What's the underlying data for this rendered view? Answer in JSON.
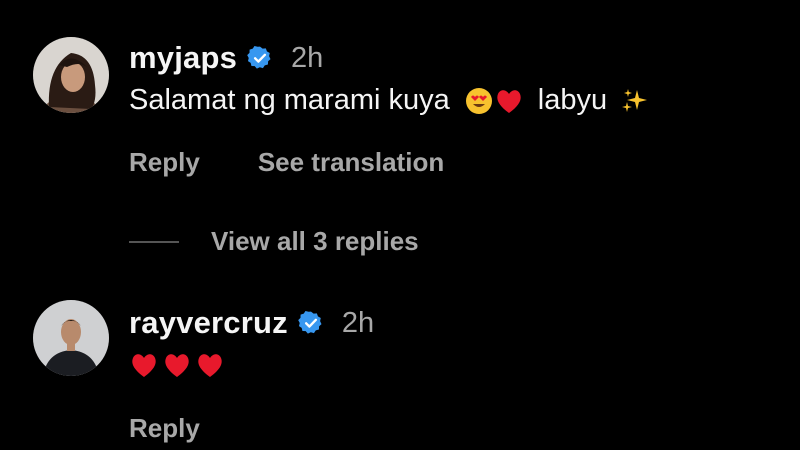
{
  "colors": {
    "background": "#000000",
    "primary_text": "#f5f5f5",
    "secondary_text": "#a8a8a8",
    "verified_badge": "#3797f0",
    "heart": "#e8192c"
  },
  "comments": [
    {
      "username": "myjaps",
      "verified": true,
      "time": "2h",
      "text_before_emoji": "Salamat ng marami kuya",
      "emojis_1": [
        "smiling-face-with-heart-eyes",
        "red-heart"
      ],
      "text_after_emoji": "labyu",
      "emojis_2": [
        "sparkles"
      ],
      "reply_label": "Reply",
      "translate_label": "See translation",
      "view_replies_label": "View all 3 replies"
    },
    {
      "username": "rayvercruz",
      "verified": true,
      "time": "2h",
      "emojis": [
        "red-heart",
        "red-heart",
        "red-heart"
      ],
      "reply_label": "Reply"
    }
  ]
}
